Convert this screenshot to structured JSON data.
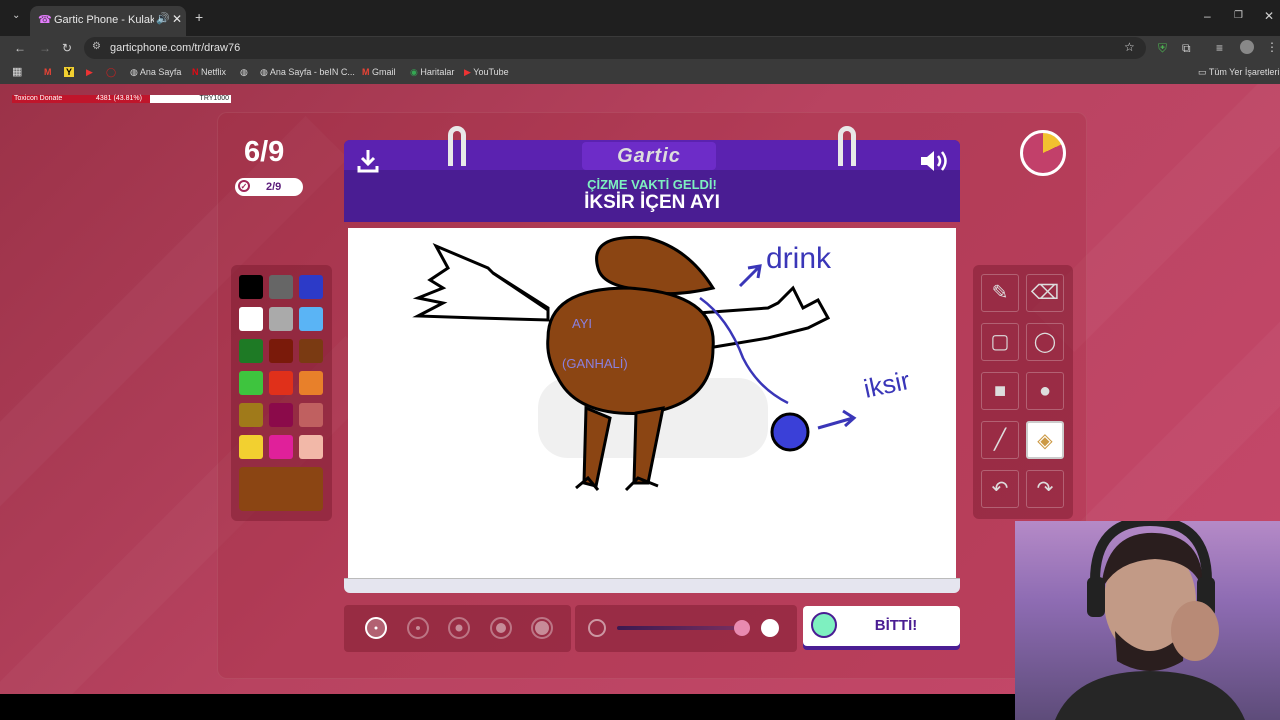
{
  "browser": {
    "tab_title": "Gartic Phone - Kulaktan Kul",
    "url": "garticphone.com/tr/draw76",
    "bookmarks": [
      "Ana Sayfa",
      "Netflix",
      "Ana Sayfa - beIN C...",
      "Gmail",
      "Haritalar",
      "YouTube"
    ],
    "all_bookmarks": "Tüm Yer İşaretleri"
  },
  "overlay": {
    "left": "Toxicon Donate",
    "mid": "4381 (43.81%)",
    "right": "TRY1000"
  },
  "game": {
    "round": "6/9",
    "score": "2/9",
    "timer_fraction": 0.18,
    "logo": "Gartic",
    "prompt_header": "ÇİZME VAKTİ GELDİ!",
    "prompt": "İKSİR İÇEN AYI",
    "done_label": "BİTTİ!",
    "selected_color": "#8b4513",
    "colors": [
      "#000000",
      "#666666",
      "#2c3ac8",
      "#ffffff",
      "#aaaaaa",
      "#5ab4f5",
      "#1e7a25",
      "#7a1a0a",
      "#7a3a12",
      "#3ec43e",
      "#e0301a",
      "#e8802a",
      "#a07a1a",
      "#8b0a4a",
      "#c06060",
      "#f2d030",
      "#e0209a",
      "#f2b8a8"
    ],
    "tools": [
      "pencil",
      "eraser",
      "rectangle-outline",
      "ellipse-outline",
      "rectangle-filled",
      "ellipse-filled",
      "line",
      "fill-bucket",
      "undo",
      "redo"
    ],
    "selected_tool": "fill-bucket",
    "drawing_labels": {
      "drink": "drink",
      "iksir": "iksir",
      "ayi": "AYI",
      "ganhaliz": "(GANHALİ)"
    }
  }
}
